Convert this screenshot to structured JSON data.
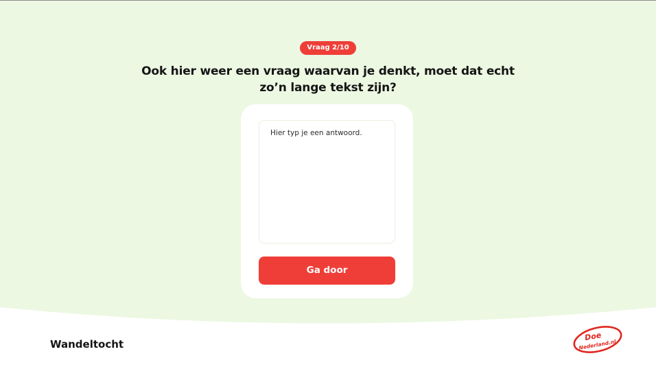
{
  "progress": {
    "badge_label": "Vraag 2/10"
  },
  "question": {
    "text": "Ook hier weer een vraag waarvan je denkt, moet dat echt zo’n lange tekst zijn?"
  },
  "answer": {
    "placeholder": "Hier typ je een antwoord.",
    "value": ""
  },
  "actions": {
    "continue_label": "Ga door"
  },
  "footer": {
    "title": "Wandeltocht",
    "logo": {
      "line1": "Doe",
      "line2": "Nederland.nl"
    }
  },
  "colors": {
    "accent": "#ef3e38",
    "background": "#ecf8e2",
    "card": "#ffffff",
    "text": "#151515"
  }
}
